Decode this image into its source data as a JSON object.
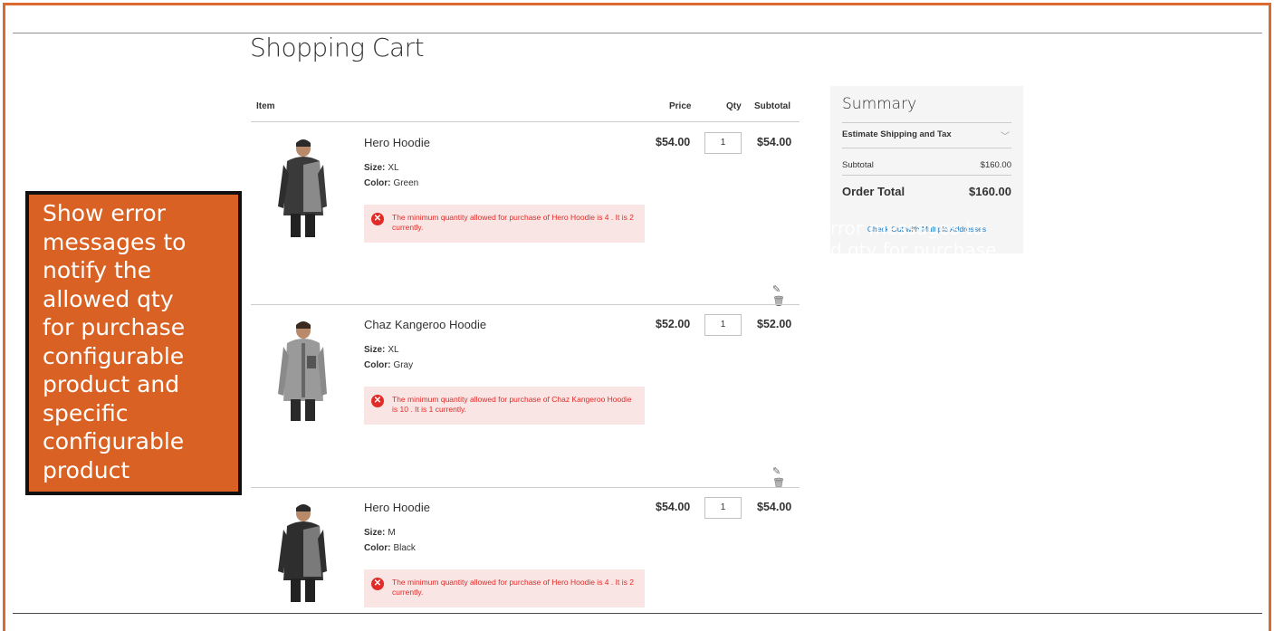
{
  "page_title": "Shopping Cart",
  "callout": {
    "lines": [
      "Show error",
      "messages to",
      "notify the",
      "allowed qty",
      "for purchase",
      "configurable",
      "product and",
      "specific",
      "configurable",
      "product"
    ]
  },
  "cart": {
    "headers": {
      "item": "Item",
      "price": "Price",
      "qty": "Qty",
      "subtotal": "Subtotal"
    },
    "items": [
      {
        "name": "Hero Hoodie",
        "size_label": "Size:",
        "size": "XL",
        "color_label": "Color:",
        "color": "Green",
        "price": "$54.00",
        "qty": "1",
        "subtotal": "$54.00",
        "error": "The minimum quantity allowed for purchase of Hero Hoodie is 4 . It is 2 currently."
      },
      {
        "name": "Chaz Kangeroo Hoodie",
        "size_label": "Size:",
        "size": "XL",
        "color_label": "Color:",
        "color": "Gray",
        "price": "$52.00",
        "qty": "1",
        "subtotal": "$52.00",
        "error": "The minimum quantity allowed for purchase of Chaz Kangeroo Hoodie is 10 . It is 1 currently."
      },
      {
        "name": "Hero Hoodie",
        "size_label": "Size:",
        "size": "M",
        "color_label": "Color:",
        "color": "Black",
        "price": "$54.00",
        "qty": "1",
        "subtotal": "$54.00",
        "error": "The minimum quantity allowed for purchase of Hero Hoodie is 4 . It is 2 currently."
      }
    ]
  },
  "summary": {
    "title": "Summary",
    "estimate_label": "Estimate Shipping and Tax",
    "subtotal_label": "Subtotal",
    "subtotal_value": "$160.00",
    "order_total_label": "Order Total",
    "order_total_value": "$160.00",
    "multi_address_link": "Check Out with Multiple Addresses"
  },
  "ghost_text": [
    "rror messages to",
    "d qty for purchase"
  ],
  "icons": {
    "edit": "pencil-icon",
    "delete": "trash-icon",
    "error": "error-x-icon",
    "expand": "chevron-down-icon"
  },
  "colors": {
    "accent_orange": "#d96123",
    "error_bg": "#fae5e5",
    "error_text": "#e02b27",
    "link_blue": "#1979c3"
  }
}
